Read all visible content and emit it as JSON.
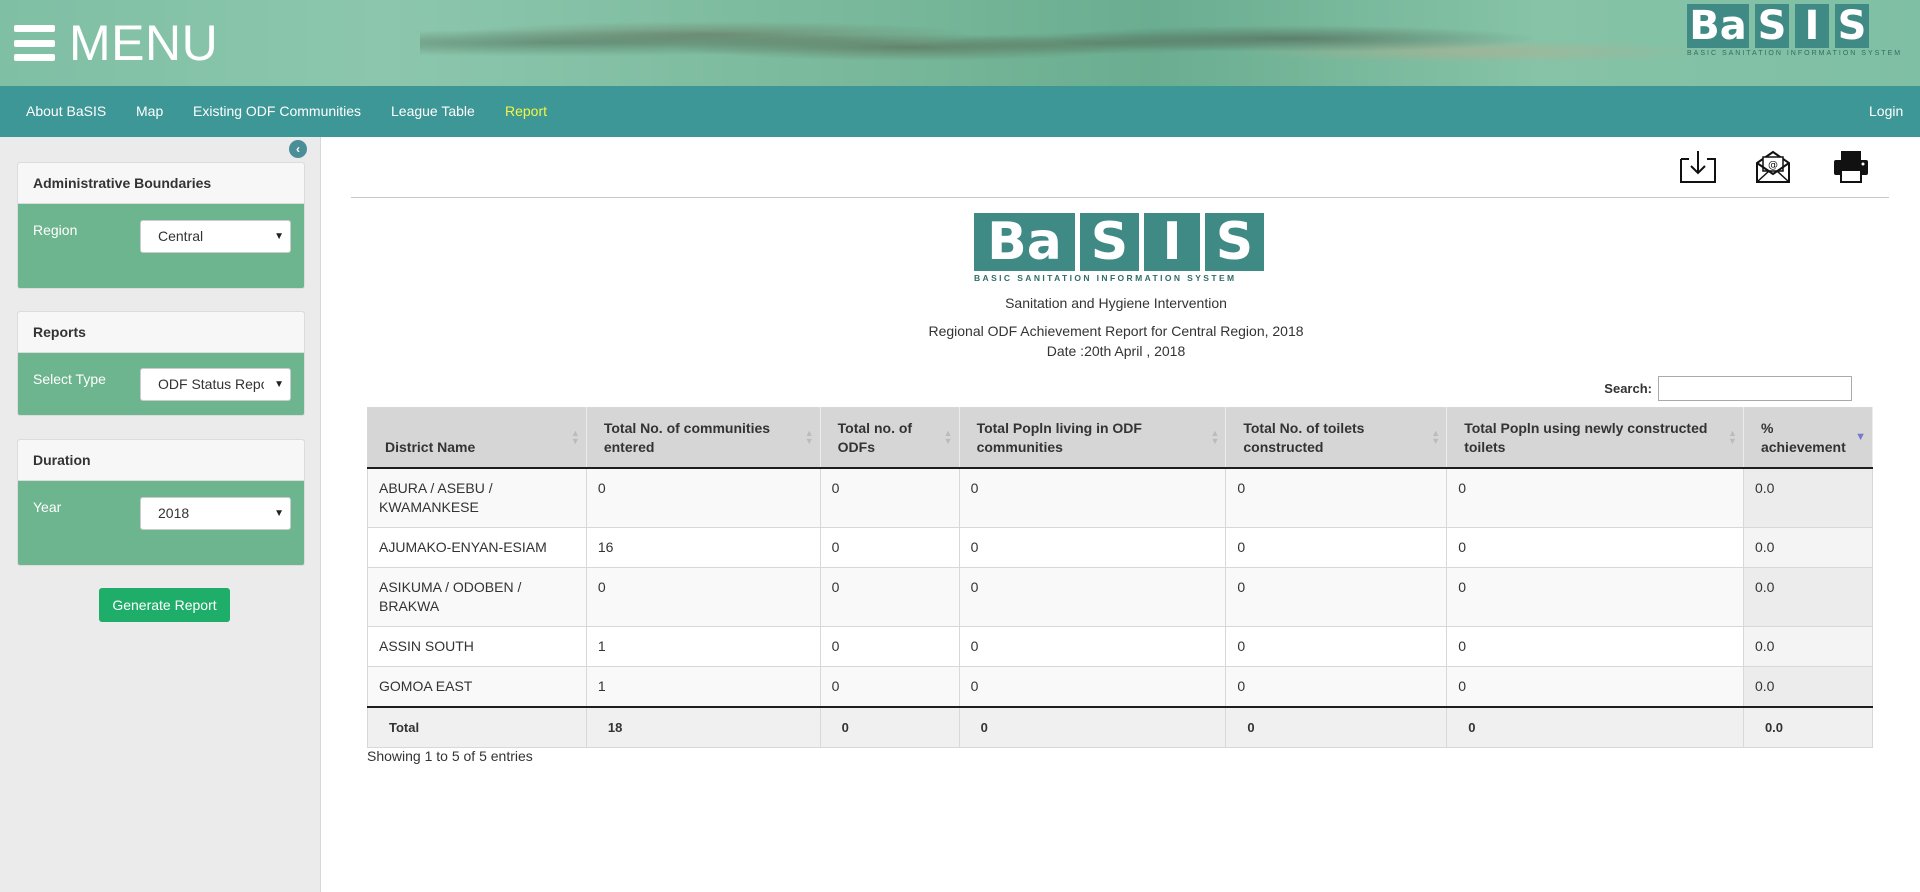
{
  "header": {
    "menu_label": "MENU",
    "logo_letters": [
      "Ba",
      "S",
      "I",
      "S"
    ],
    "logo_tagline": "BASIC SANITATION INFORMATION SYSTEM"
  },
  "nav": {
    "items": [
      "About BaSIS",
      "Map",
      "Existing ODF Communities",
      "League Table",
      "Report"
    ],
    "active": "Report",
    "login": "Login"
  },
  "sidebar": {
    "panels": [
      {
        "title": "Administrative Boundaries",
        "label": "Region",
        "value": "Central"
      },
      {
        "title": "Reports",
        "label": "Select Type",
        "value": "ODF Status Report"
      },
      {
        "title": "Duration",
        "label": "Year",
        "value": "2018"
      }
    ],
    "generate_label": "Generate Report"
  },
  "toolbar": {
    "icons": [
      "download-icon",
      "email-icon",
      "print-icon"
    ]
  },
  "report": {
    "logo_letters": [
      "Ba",
      "S",
      "I",
      "S"
    ],
    "logo_tagline": "BASIC SANITATION INFORMATION SYSTEM",
    "subtitle": "Sanitation and Hygiene Intervention",
    "title": "Regional ODF Achievement Report for Central Region, 2018",
    "date": "Date :20th April , 2018"
  },
  "search": {
    "label": "Search:",
    "value": ""
  },
  "table": {
    "columns": [
      "District Name",
      "Total No. of communities entered",
      "Total no. of ODFs",
      "Total Popln living in ODF communities",
      "Total No. of toilets constructed",
      "Total Popln using newly constructed toilets",
      "% achievement"
    ],
    "sorted_column": "% achievement",
    "rows": [
      [
        "ABURA / ASEBU / KWAMANKESE",
        "0",
        "0",
        "0",
        "0",
        "0",
        "0.0"
      ],
      [
        "AJUMAKO-ENYAN-ESIAM",
        "16",
        "0",
        "0",
        "0",
        "0",
        "0.0"
      ],
      [
        "ASIKUMA / ODOBEN / BRAKWA",
        "0",
        "0",
        "0",
        "0",
        "0",
        "0.0"
      ],
      [
        "ASSIN SOUTH",
        "1",
        "0",
        "0",
        "0",
        "0",
        "0.0"
      ],
      [
        "GOMOA EAST",
        "1",
        "0",
        "0",
        "0",
        "0",
        "0.0"
      ]
    ],
    "totals": [
      "Total",
      "18",
      "0",
      "0",
      "0",
      "0",
      "0.0"
    ],
    "info": "Showing 1 to 5 of 5 entries"
  },
  "colors": {
    "nav_bg": "#3d9796",
    "nav_active": "#f5f542",
    "panel_body": "#6db58f",
    "logo_block": "#3f8a84",
    "generate_btn": "#1fad6a"
  }
}
